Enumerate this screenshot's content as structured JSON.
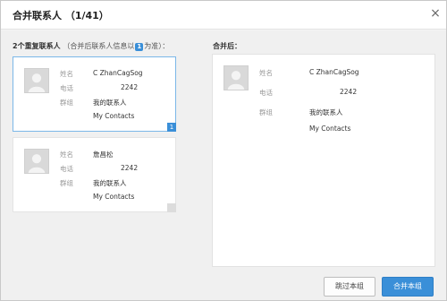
{
  "dialog": {
    "title": "合并联系人 （1/41）",
    "close_glyph": "×"
  },
  "left": {
    "heading_bold": "2个重复联系人",
    "heading_sub_pre": "（合并后联系人信息以",
    "heading_badge": "1",
    "heading_sub_post": "为准）：",
    "cards": [
      {
        "name_label": "姓名",
        "name_value": "C ZhanCagSog",
        "phone_label": "电话",
        "phone_value": "2242",
        "group_label": "群组",
        "group_values": [
          "我的联系人",
          "My Contacts"
        ],
        "corner_badge": "1",
        "selected": true
      },
      {
        "name_label": "姓名",
        "name_value": "詹昌松",
        "phone_label": "电话",
        "phone_value": "2242",
        "group_label": "群组",
        "group_values": [
          "我的联系人",
          "My Contacts"
        ],
        "corner_badge": "",
        "selected": false
      }
    ]
  },
  "right": {
    "heading": "合并后：",
    "name_label": "姓名",
    "name_value": "C ZhanCagSog",
    "phone_label": "电话",
    "phone_value": "2242",
    "group_label": "群组",
    "group_values": [
      "我的联系人",
      "My Contacts"
    ]
  },
  "footer": {
    "skip_label": "跳过本组",
    "merge_label": "合并本组"
  },
  "colors": {
    "accent": "#3a8fd8",
    "selected_border": "#7bb7e8"
  }
}
